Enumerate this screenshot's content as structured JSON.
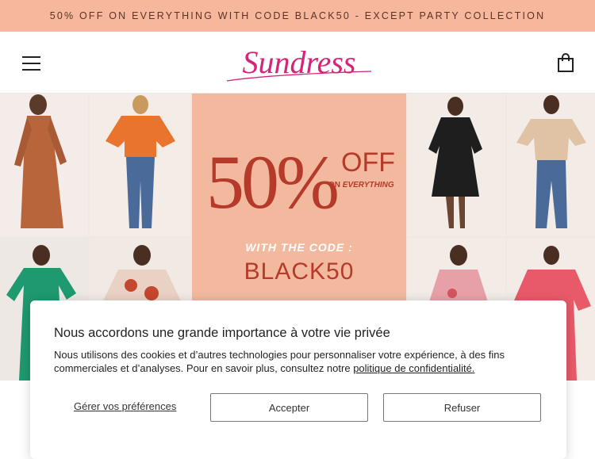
{
  "announcement": "50% OFF ON EVERYTHING WITH CODE BLACK50 - EXCEPT PARTY COLLECTION",
  "header": {
    "logo_text": "Sundress",
    "menu_icon": "hamburger-menu-icon",
    "cart_icon": "shopping-bag-icon"
  },
  "hero": {
    "percent": "50%",
    "off": "OFF",
    "on_everything_prefix": "ON",
    "on_everything": "EVERYTHING",
    "with_code": "WITH THE CODE :",
    "code": "BLACK50"
  },
  "cookie_banner": {
    "title": "Nous accordons une grande importance à votre vie privée",
    "body": "Nous utilisons des cookies et d’autres technologies pour personnaliser votre expérience, à des fins commerciales et d’analyses. Pour en savoir plus, consultez notre ",
    "privacy_link": "politique de confidentialité.",
    "manage_label": "Gérer vos préférences",
    "accept_label": "Accepter",
    "refuse_label": "Refuser"
  },
  "colors": {
    "announcement_bg": "#f6b79d",
    "logo": "#d6247a",
    "promo_bg": "#f2b99e",
    "promo_text": "#b53a2a"
  }
}
